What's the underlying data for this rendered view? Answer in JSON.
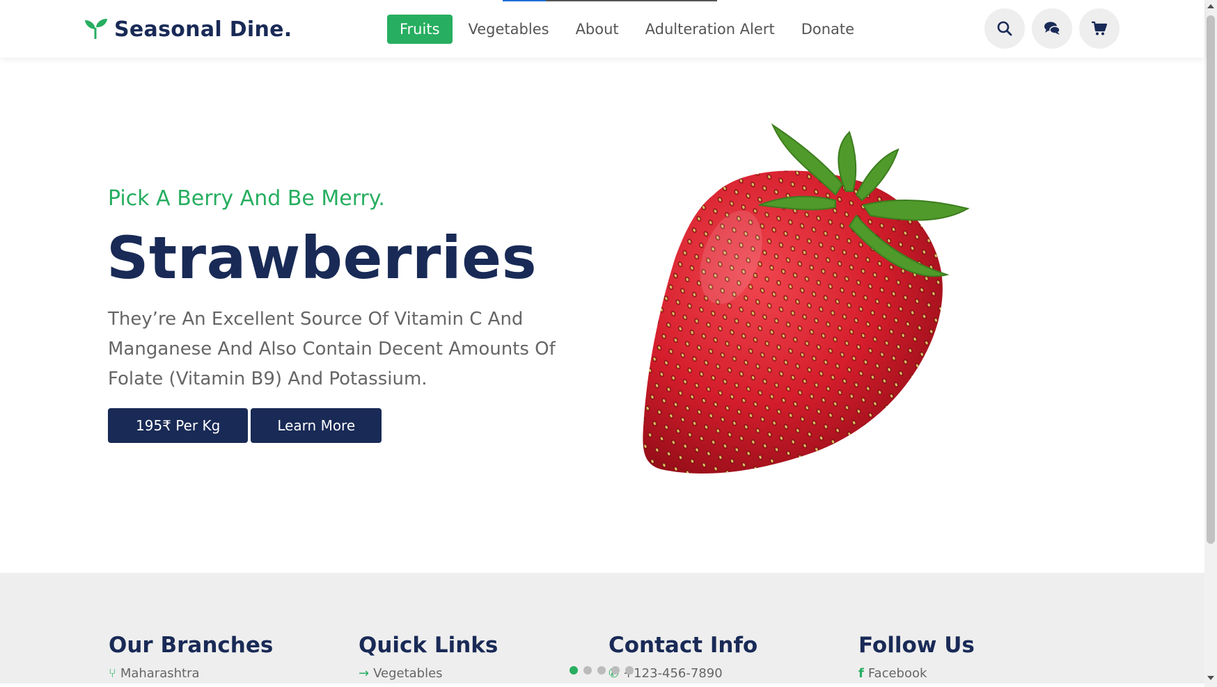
{
  "brand": {
    "name": "Seasonal Dine.",
    "logo_icon": "sprout-icon",
    "accent": "#27ae60",
    "navy": "#192a56"
  },
  "nav": {
    "items": [
      {
        "label": "Fruits",
        "active": true
      },
      {
        "label": "Vegetables"
      },
      {
        "label": "About"
      },
      {
        "label": "Adulteration Alert"
      },
      {
        "label": "Donate"
      }
    ]
  },
  "header_icons": [
    "search-icon",
    "chat-icon",
    "cart-icon"
  ],
  "hero": {
    "subtitle": "Pick A Berry And Be Merry.",
    "title": "Strawberries",
    "description": "They’re An Excellent Source Of Vitamin C And Manganese And Also Contain Decent Amounts Of Folate (Vitamin B9) And Potassium.",
    "price_button": "195₹ Per Kg",
    "learn_button": "Learn More",
    "image": "strawberry-image"
  },
  "slider": {
    "count": 5,
    "active_index": 0
  },
  "footer": {
    "branches": {
      "heading": "Our Branches",
      "first_item": "Maharashtra"
    },
    "quick_links": {
      "heading": "Quick Links",
      "first_item": "Vegetables"
    },
    "contact": {
      "heading": "Contact Info",
      "first_item": "+123-456-7890"
    },
    "follow": {
      "heading": "Follow Us",
      "first_item": "Facebook"
    }
  }
}
